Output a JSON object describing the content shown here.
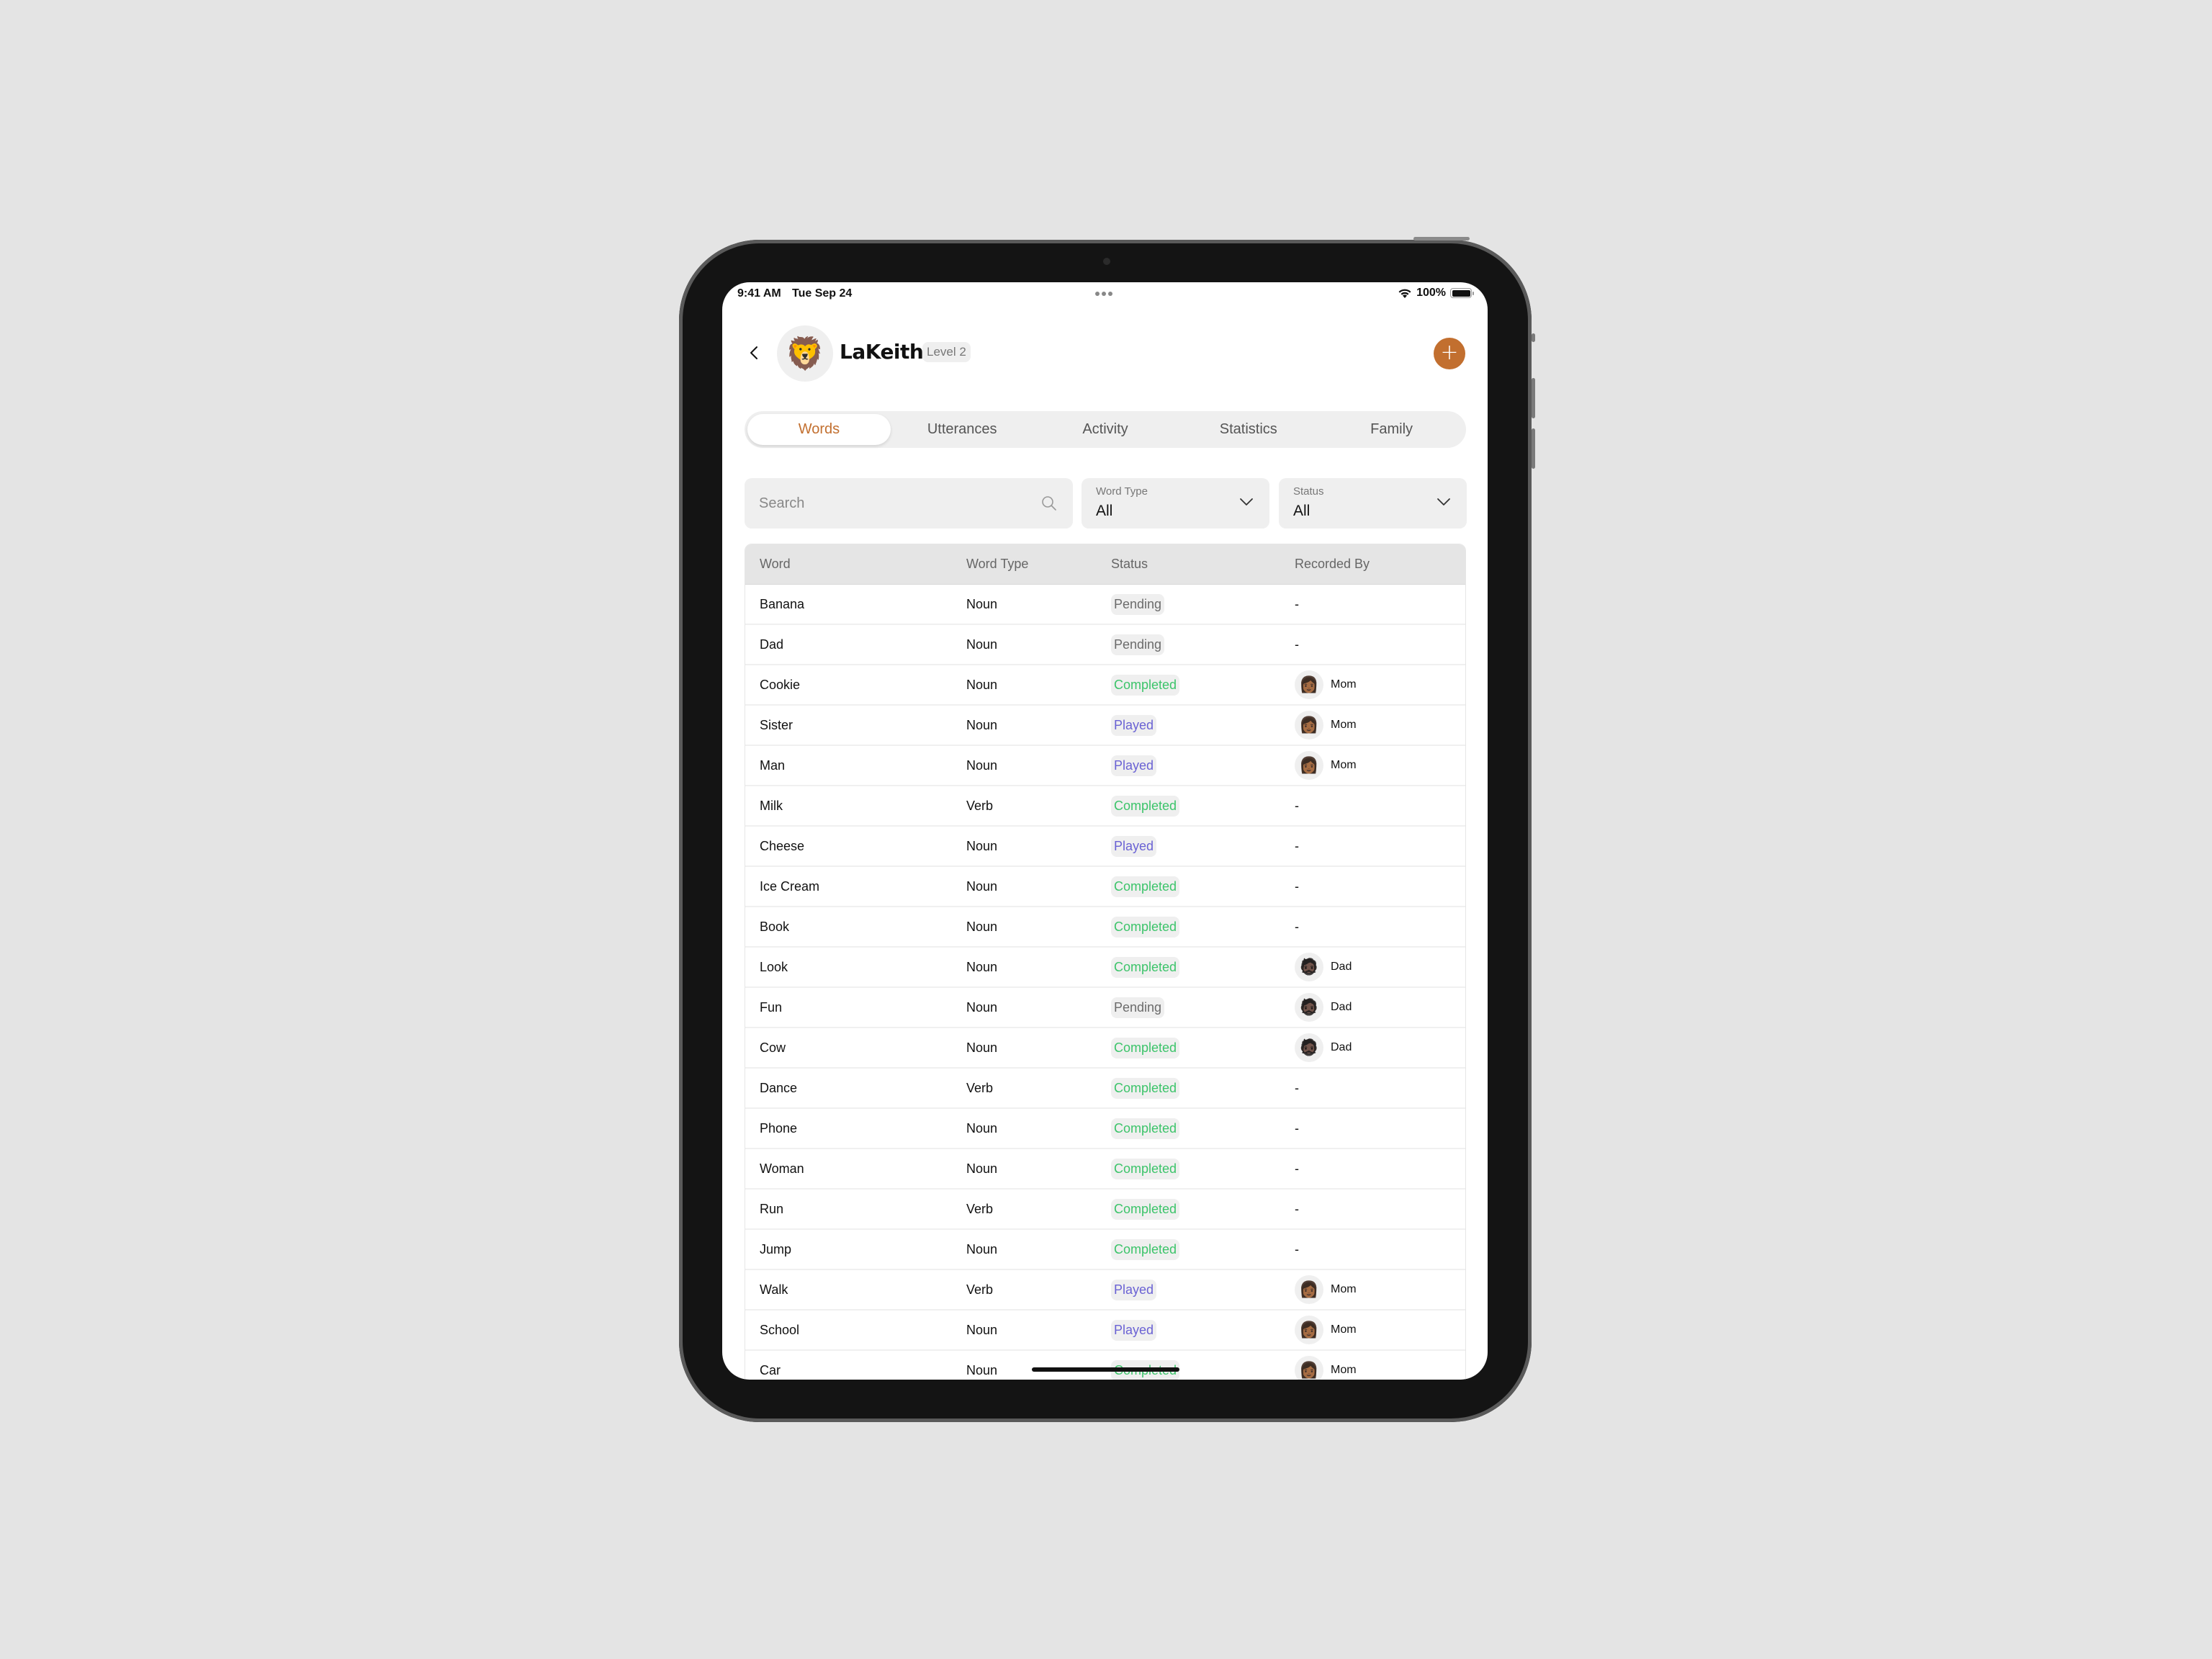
{
  "status_bar": {
    "time": "9:41 AM",
    "date": "Tue Sep 24",
    "battery": "100%"
  },
  "header": {
    "avatar_emoji": "🦁",
    "name": "LaKeith",
    "level": "Level 2",
    "add_label": "+"
  },
  "tabs": [
    {
      "label": "Words",
      "active": true
    },
    {
      "label": "Utterances",
      "active": false
    },
    {
      "label": "Activity",
      "active": false
    },
    {
      "label": "Statistics",
      "active": false
    },
    {
      "label": "Family",
      "active": false
    }
  ],
  "filters": {
    "search_placeholder": "Search",
    "search_value": "",
    "word_type": {
      "label": "Word Type",
      "value": "All"
    },
    "status": {
      "label": "Status",
      "value": "All"
    }
  },
  "table": {
    "columns": [
      "Word",
      "Word Type",
      "Status",
      "Recorded By"
    ],
    "rows": [
      {
        "word": "Banana",
        "type": "Noun",
        "status": "Pending",
        "by": "-",
        "avatar": ""
      },
      {
        "word": "Dad",
        "type": "Noun",
        "status": "Pending",
        "by": "-",
        "avatar": ""
      },
      {
        "word": "Cookie",
        "type": "Noun",
        "status": "Completed",
        "by": "Mom",
        "avatar": "👩🏾"
      },
      {
        "word": "Sister",
        "type": "Noun",
        "status": "Played",
        "by": "Mom",
        "avatar": "👩🏾"
      },
      {
        "word": "Man",
        "type": "Noun",
        "status": "Played",
        "by": "Mom",
        "avatar": "👩🏾"
      },
      {
        "word": "Milk",
        "type": "Verb",
        "status": "Completed",
        "by": "-",
        "avatar": ""
      },
      {
        "word": "Cheese",
        "type": "Noun",
        "status": "Played",
        "by": "-",
        "avatar": ""
      },
      {
        "word": "Ice Cream",
        "type": "Noun",
        "status": "Completed",
        "by": "-",
        "avatar": ""
      },
      {
        "word": "Book",
        "type": "Noun",
        "status": "Completed",
        "by": "-",
        "avatar": ""
      },
      {
        "word": "Look",
        "type": "Noun",
        "status": "Completed",
        "by": "Dad",
        "avatar": "🧔🏿"
      },
      {
        "word": "Fun",
        "type": "Noun",
        "status": "Pending",
        "by": "Dad",
        "avatar": "🧔🏿"
      },
      {
        "word": "Cow",
        "type": "Noun",
        "status": "Completed",
        "by": "Dad",
        "avatar": "🧔🏿"
      },
      {
        "word": "Dance",
        "type": "Verb",
        "status": "Completed",
        "by": "-",
        "avatar": ""
      },
      {
        "word": "Phone",
        "type": "Noun",
        "status": "Completed",
        "by": "-",
        "avatar": ""
      },
      {
        "word": "Woman",
        "type": "Noun",
        "status": "Completed",
        "by": "-",
        "avatar": ""
      },
      {
        "word": "Run",
        "type": "Verb",
        "status": "Completed",
        "by": "-",
        "avatar": ""
      },
      {
        "word": "Jump",
        "type": "Noun",
        "status": "Completed",
        "by": "-",
        "avatar": ""
      },
      {
        "word": "Walk",
        "type": "Verb",
        "status": "Played",
        "by": "Mom",
        "avatar": "👩🏾"
      },
      {
        "word": "School",
        "type": "Noun",
        "status": "Played",
        "by": "Mom",
        "avatar": "👩🏾"
      },
      {
        "word": "Car",
        "type": "Noun",
        "status": "Completed",
        "by": "Mom",
        "avatar": "👩🏾"
      }
    ]
  },
  "colors": {
    "accent": "#c26f2f",
    "pending": "#6b6b6b",
    "completed": "#3cc46a",
    "played": "#6a62d4"
  }
}
